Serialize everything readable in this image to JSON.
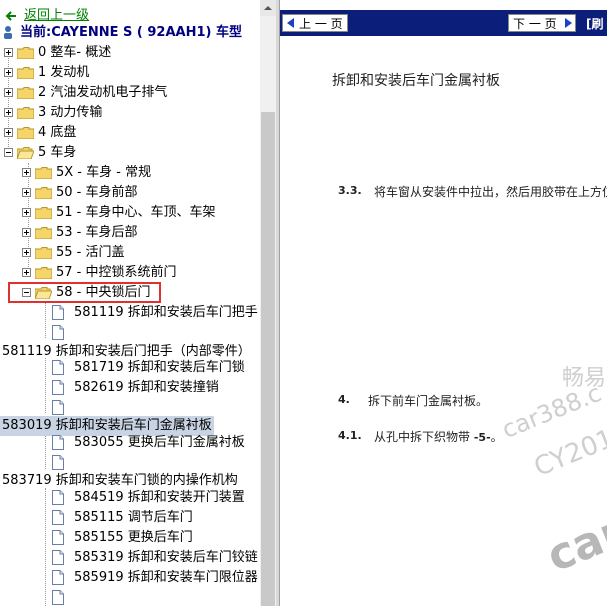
{
  "tree": {
    "back_link": "返回上一级",
    "current_label": "当前:CAYENNE S ( 92AAH1) 车型",
    "items": [
      "0 整车- 概述",
      "1 发动机",
      "2 汽油发动机电子排气",
      "3 动力传输",
      "4 底盘",
      "5 车身"
    ],
    "sub_items": [
      "5X - 车身 - 常规",
      "50 - 车身前部",
      "51 - 车身中心、车顶、车架",
      "53 - 车身后部",
      "55 - 活门盖",
      "57 - 中控锁系统前门",
      "58 - 中央锁后门"
    ],
    "group1_title": "581119 拆卸和安装后门把手（内部零件）",
    "group1_children": [
      "581119 拆卸和安装后车门把手",
      "",
      "581719 拆卸和安装后车门锁",
      "582619 拆卸和安装撞销",
      ""
    ],
    "group2_title": "583019 拆卸和安装后车门金属衬板",
    "group2_children": [
      "583055 更换后车门金属衬板",
      ""
    ],
    "group3_title": "583719 拆卸和安装车门锁的内操作机构",
    "group3_children": [
      "584519 拆卸和安装开门装置",
      "585115 调节后车门",
      "585155 更换后车门",
      "585319 拆卸和安装后车门铰链",
      "585919 拆卸和安装车门限位器",
      ""
    ]
  },
  "toolbar": {
    "prev_label": "上 一 页",
    "next_label": "下 一 页",
    "refresh_label": "[刷"
  },
  "doc": {
    "heading": "拆卸和安装后车门金属衬板",
    "step1_num": "3.3.",
    "step1_text": "将车窗从安装件中拉出，然后用胶带在上方位",
    "step2_num": "4.",
    "step2_text": "拆下前车门金属衬板。",
    "step3_num": "4.1.",
    "step3_text": "从孔中拆下织物带",
    "step3_ref": "-5-",
    "step3_tail": "。"
  },
  "watermark": {
    "line1": "畅易",
    "line2": "car388.c",
    "line3": "CY201",
    "line4": "car"
  },
  "colors": {
    "toolbar_bg": "#0b1e7a",
    "tree_back_link": "#008000",
    "tree_current": "#000080",
    "selection_bg": "#c8d4e4",
    "annotation_box": "#e03030"
  }
}
